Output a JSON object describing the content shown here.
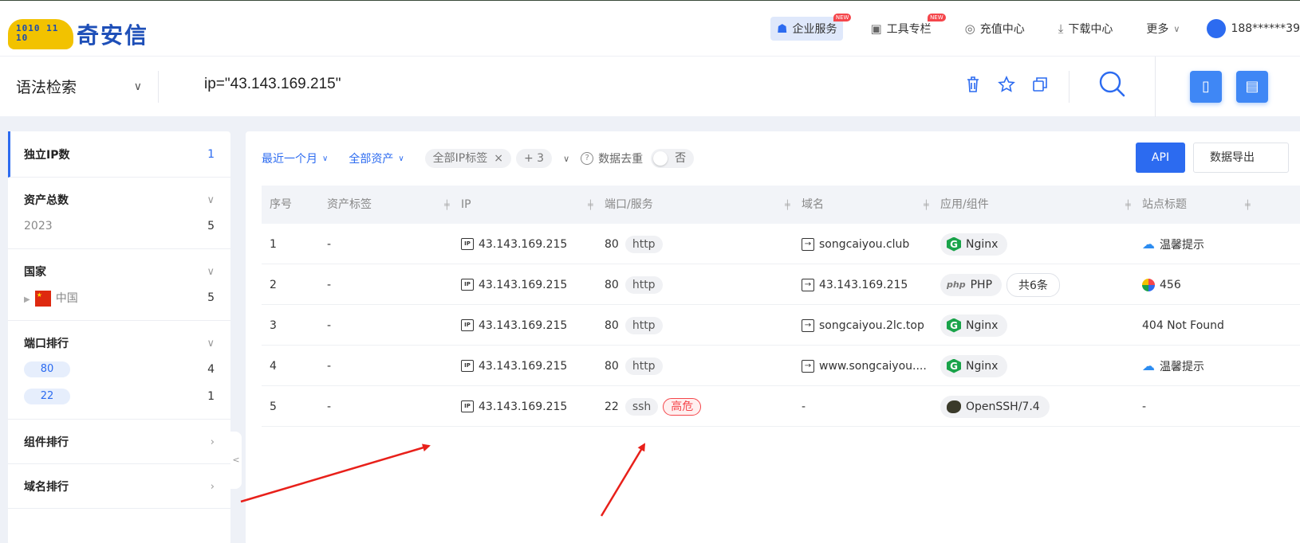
{
  "header": {
    "logo_text": "奇安信",
    "logo_bits": "1010 11 10",
    "nav": [
      {
        "label": "企业服务",
        "icon": "building-icon",
        "badge": "NEW",
        "active": true
      },
      {
        "label": "工具专栏",
        "icon": "toolbox-icon",
        "badge": "NEW"
      },
      {
        "label": "充值中心",
        "icon": "yen-icon"
      },
      {
        "label": "下载中心",
        "icon": "download-icon"
      },
      {
        "label": "更多",
        "icon": ""
      }
    ],
    "user": "188******39"
  },
  "search": {
    "syntax_label": "语法检索",
    "query": "ip=\"43.143.169.215\""
  },
  "sidebar": {
    "unique_ip": {
      "label": "独立IP数",
      "count": "1"
    },
    "total_assets": {
      "label": "资产总数",
      "rows": [
        {
          "label": "2023",
          "count": "5"
        }
      ]
    },
    "country": {
      "label": "国家",
      "rows": [
        {
          "label": "中国",
          "count": "5"
        }
      ]
    },
    "ports": {
      "label": "端口排行",
      "rows": [
        {
          "label": "80",
          "count": "4"
        },
        {
          "label": "22",
          "count": "1"
        }
      ]
    },
    "components": {
      "label": "组件排行"
    },
    "domains": {
      "label": "域名排行"
    },
    "collapse": "<"
  },
  "filters": {
    "time": "最近一个月",
    "assets": "全部资产",
    "ip_tag": "全部IP标签",
    "ip_tag_close": "×",
    "more": "+ 3",
    "dedup": "数据去重",
    "dedup_help": "?",
    "dedup_value": "否",
    "api": "API",
    "export": "数据导出"
  },
  "table": {
    "headers": [
      "序号",
      "资产标签",
      "IP",
      "端口/服务",
      "域名",
      "应用/组件",
      "站点标题"
    ],
    "rows": [
      {
        "no": "1",
        "tag": "-",
        "ip": "43.143.169.215",
        "port": "80",
        "service": "http",
        "risk": "",
        "domain": "songcaiyou.club",
        "apps": [
          {
            "name": "Nginx",
            "type": "nginx"
          }
        ],
        "extra": "",
        "title": "温馨提示",
        "title_icon": "cloud"
      },
      {
        "no": "2",
        "tag": "-",
        "ip": "43.143.169.215",
        "port": "80",
        "service": "http",
        "risk": "",
        "domain": "43.143.169.215",
        "apps": [
          {
            "name": "PHP",
            "type": "php"
          }
        ],
        "extra": "共6条",
        "title": "456",
        "title_icon": "multi"
      },
      {
        "no": "3",
        "tag": "-",
        "ip": "43.143.169.215",
        "port": "80",
        "service": "http",
        "risk": "",
        "domain": "songcaiyou.2lc.top",
        "apps": [
          {
            "name": "Nginx",
            "type": "nginx"
          }
        ],
        "extra": "",
        "title": "404 Not Found",
        "title_icon": ""
      },
      {
        "no": "4",
        "tag": "-",
        "ip": "43.143.169.215",
        "port": "80",
        "service": "http",
        "risk": "",
        "domain": "www.songcaiyou....",
        "apps": [
          {
            "name": "Nginx",
            "type": "nginx"
          }
        ],
        "extra": "",
        "title": "温馨提示",
        "title_icon": "cloud"
      },
      {
        "no": "5",
        "tag": "-",
        "ip": "43.143.169.215",
        "port": "22",
        "service": "ssh",
        "risk": "高危",
        "domain": "-",
        "apps": [
          {
            "name": "OpenSSH/7.4",
            "type": "ssh"
          }
        ],
        "extra": "",
        "title": "-",
        "title_icon": ""
      }
    ]
  },
  "colors": {
    "accent": "#2c6bf0",
    "danger": "#f5464b",
    "arrow": "#e8201a"
  }
}
